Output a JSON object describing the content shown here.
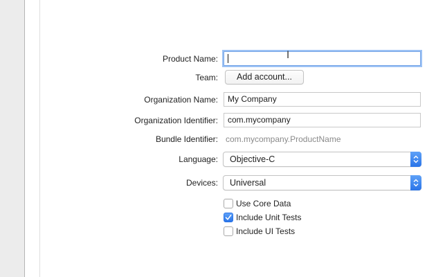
{
  "form": {
    "product_name": {
      "label": "Product Name:",
      "value": ""
    },
    "team": {
      "label": "Team:",
      "button_label": "Add account..."
    },
    "organization_name": {
      "label": "Organization Name:",
      "value": "My Company"
    },
    "organization_identifier": {
      "label": "Organization Identifier:",
      "value": "com.mycompany"
    },
    "bundle_identifier": {
      "label": "Bundle Identifier:",
      "value": "com.mycompany.ProductName"
    },
    "language": {
      "label": "Language:",
      "selected": "Objective-C"
    },
    "devices": {
      "label": "Devices:",
      "selected": "Universal"
    },
    "options": [
      {
        "label": "Use Core Data",
        "checked": false
      },
      {
        "label": "Include Unit Tests",
        "checked": true
      },
      {
        "label": "Include UI Tests",
        "checked": false
      }
    ]
  },
  "colors": {
    "accent": "#2a74e8",
    "focus_ring": "#9cc2f5",
    "placeholder_text": "#8a8a8a"
  }
}
